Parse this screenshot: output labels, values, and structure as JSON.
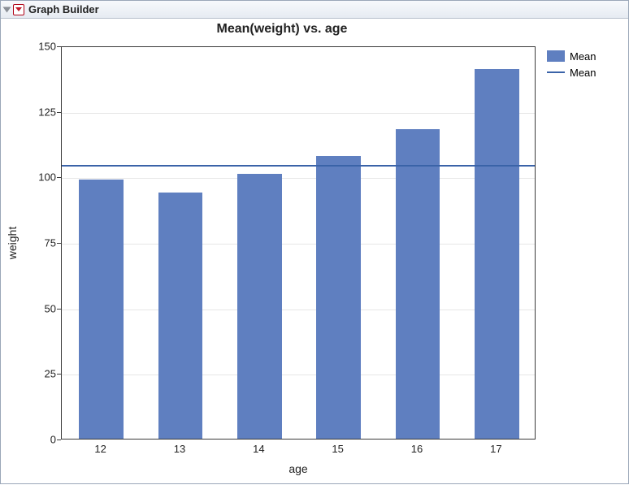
{
  "panel": {
    "title": "Graph Builder"
  },
  "chart_data": {
    "type": "bar",
    "title": "Mean(weight) vs. age",
    "xlabel": "age",
    "ylabel": "weight",
    "categories": [
      "12",
      "13",
      "14",
      "15",
      "16",
      "17"
    ],
    "values": [
      99,
      94,
      101,
      108,
      118,
      141
    ],
    "reference_line": 105,
    "ylim": [
      0,
      150
    ],
    "yticks": [
      0,
      25,
      50,
      75,
      100,
      125,
      150
    ],
    "legend": [
      {
        "label": "Mean",
        "kind": "box"
      },
      {
        "label": "Mean",
        "kind": "line"
      }
    ],
    "bar_color": "#5f7fc0",
    "line_color": "#3a63a8"
  }
}
